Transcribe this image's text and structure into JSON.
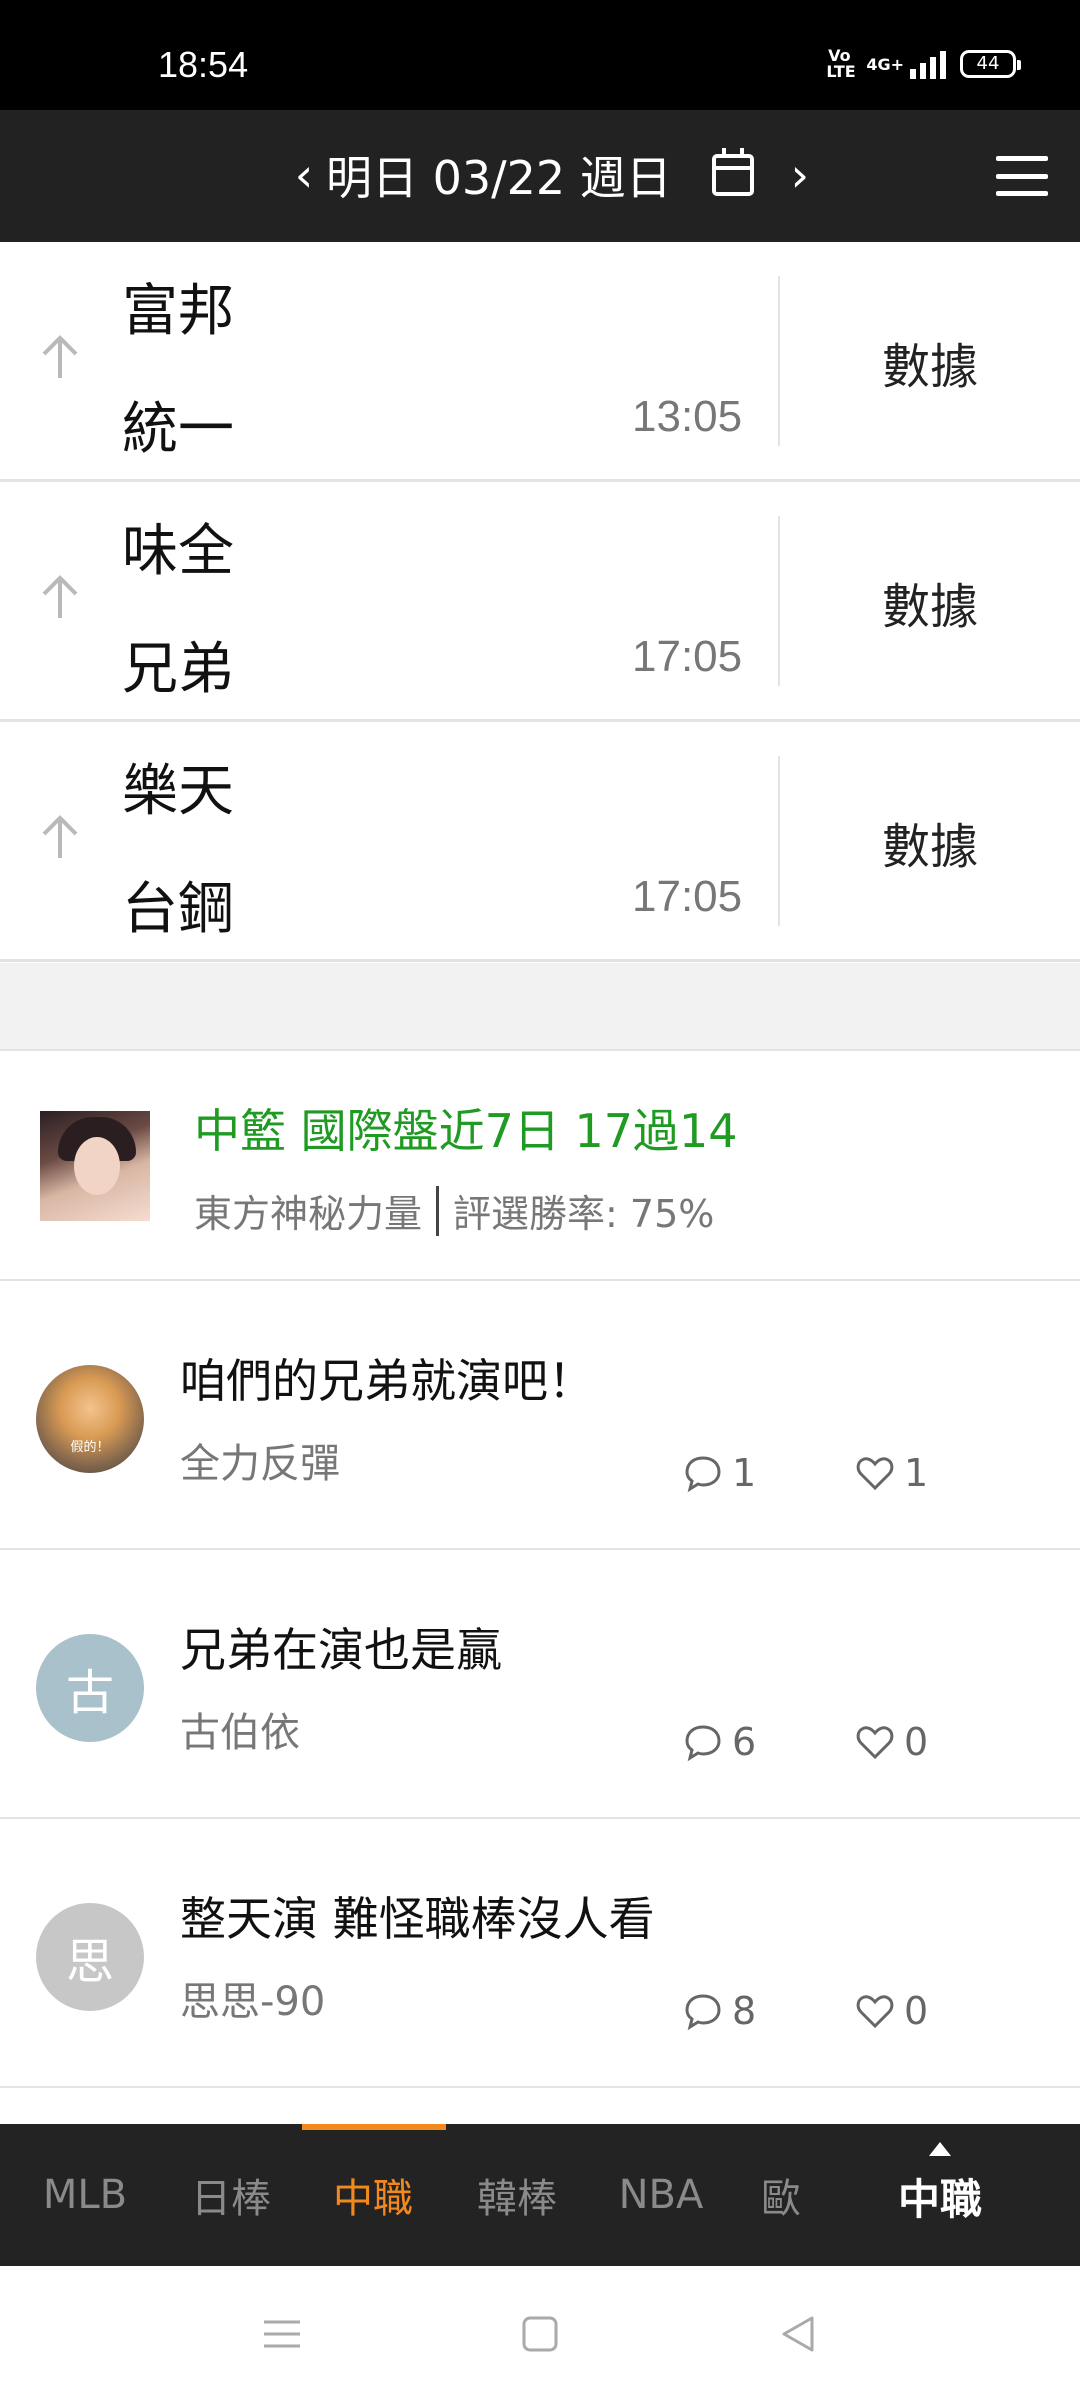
{
  "status_bar": {
    "time": "18:54",
    "volte": "Vo LTE",
    "network": "4G+",
    "battery": "44"
  },
  "top_nav": {
    "prev_arrow": "‹",
    "date_label": "明日 03/22 週日",
    "next_arrow": "›"
  },
  "games": [
    {
      "home": "富邦",
      "away": "統一",
      "time": "13:05",
      "stats_label": "數據"
    },
    {
      "home": "味全",
      "away": "兄弟",
      "time": "17:05",
      "stats_label": "數據"
    },
    {
      "home": "樂天",
      "away": "台鋼",
      "time": "17:05",
      "stats_label": "數據"
    }
  ],
  "promo": {
    "headline": "中籃 國際盤近7日 17過14",
    "author": "東方神秘力量",
    "win_rate": "評選勝率: 75%",
    "headline_color": "#1f9a22"
  },
  "posts": [
    {
      "title": "咱們的兄弟就演吧！",
      "author": "全力反彈",
      "comments": "1",
      "likes": "1",
      "avatar_text": "",
      "avatar_tag": "假的！"
    },
    {
      "title": "兄弟在演也是贏",
      "author": "古伯依",
      "comments": "6",
      "likes": "0",
      "avatar_text": "古",
      "avatar_color": "#a9c1cb"
    },
    {
      "title": "整天演 難怪職棒沒人看",
      "author": "思思-90",
      "comments": "8",
      "likes": "0",
      "avatar_text": "思",
      "avatar_color": "#c7c7c7"
    }
  ],
  "bottom_tabs": {
    "items": [
      "MLB",
      "日棒",
      "中職",
      "韓棒",
      "NBA",
      "歐"
    ],
    "active": "中職",
    "current_league": "中職",
    "accent_color": "#f2891e"
  }
}
